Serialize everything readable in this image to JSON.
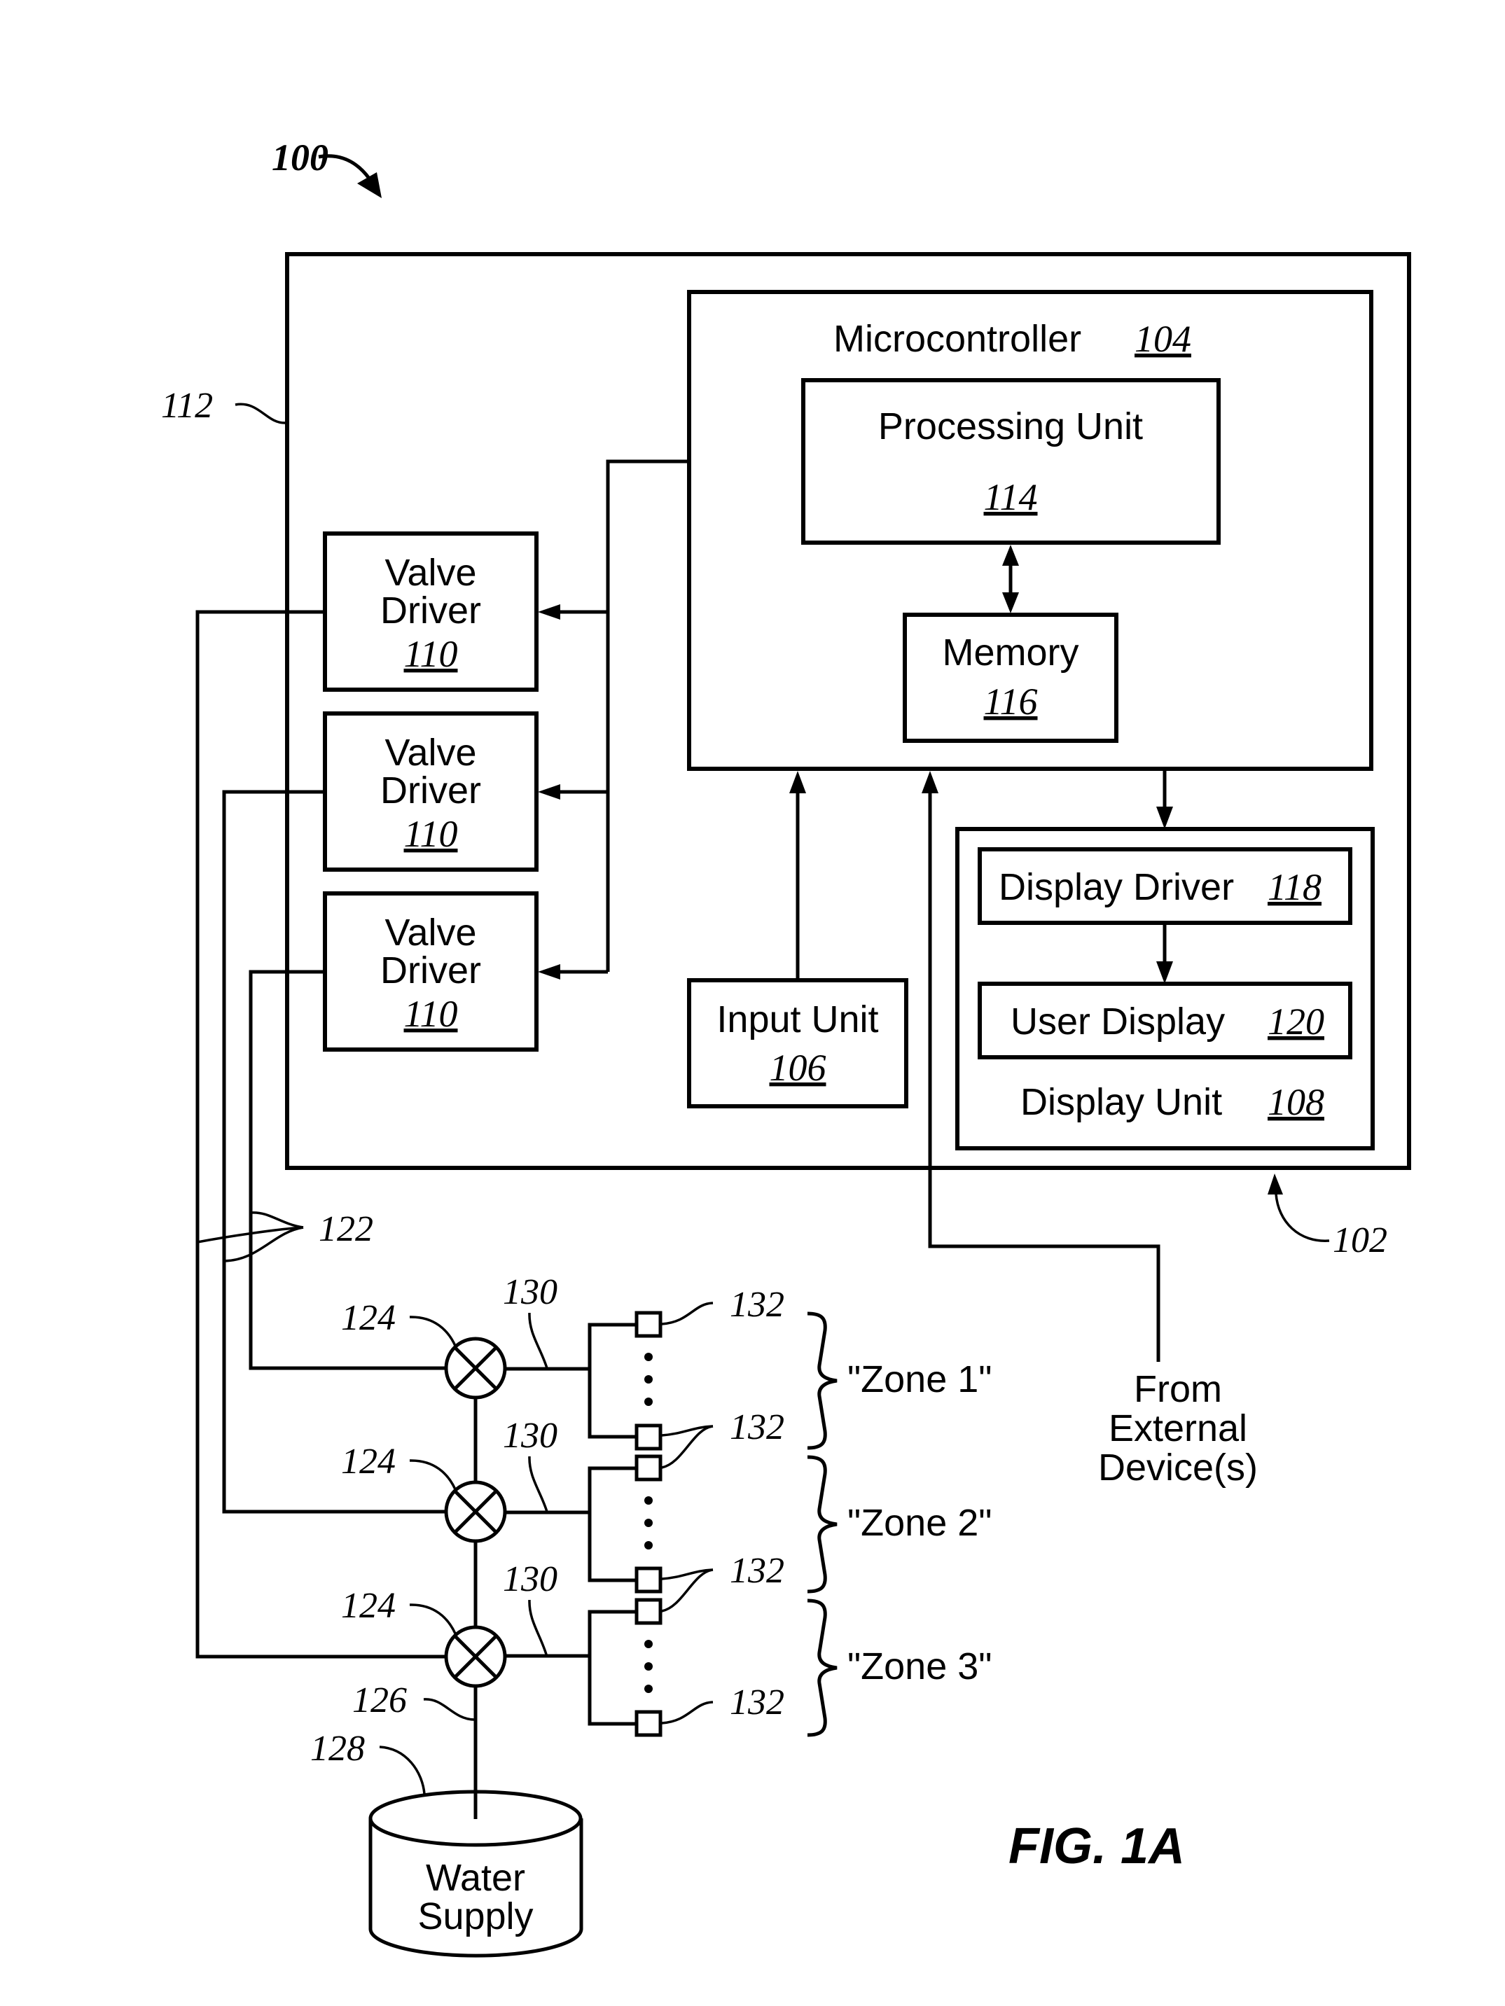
{
  "figure": {
    "label": "FIG. 1A",
    "system_ref": "100",
    "controller_ref": "102",
    "housing_ref": "112"
  },
  "microcontroller": {
    "label": "Microcontroller",
    "ref": "104"
  },
  "processing_unit": {
    "label": "Processing Unit",
    "ref": "114"
  },
  "memory": {
    "label": "Memory",
    "ref": "116"
  },
  "input_unit": {
    "label": "Input Unit",
    "ref": "106"
  },
  "display_unit": {
    "label": "Display Unit",
    "ref": "108",
    "driver": {
      "label": "Display Driver",
      "ref": "118"
    },
    "user_display": {
      "label": "User Display",
      "ref": "120"
    }
  },
  "valve_drivers": [
    {
      "line1": "Valve",
      "line2": "Driver",
      "ref": "110"
    },
    {
      "line1": "Valve",
      "line2": "Driver",
      "ref": "110"
    },
    {
      "line1": "Valve",
      "line2": "Driver",
      "ref": "110"
    }
  ],
  "external": {
    "line1": "From",
    "line2": "External",
    "line3": "Device(s)"
  },
  "wiring_ref": "122",
  "valves": [
    {
      "ref": "124",
      "line_ref": "130"
    },
    {
      "ref": "124",
      "line_ref": "130"
    },
    {
      "ref": "124",
      "line_ref": "130"
    }
  ],
  "zones": [
    {
      "label": "\"Zone 1\"",
      "sprinkler_ref_top": "132",
      "sprinkler_ref_bottom": "132"
    },
    {
      "label": "\"Zone 2\"",
      "sprinkler_ref_bottom": "132"
    },
    {
      "label": "\"Zone 3\"",
      "sprinkler_ref_bottom": "132"
    }
  ],
  "supply_line_ref": "126",
  "water_supply": {
    "ref": "128",
    "line1": "Water",
    "line2": "Supply"
  }
}
